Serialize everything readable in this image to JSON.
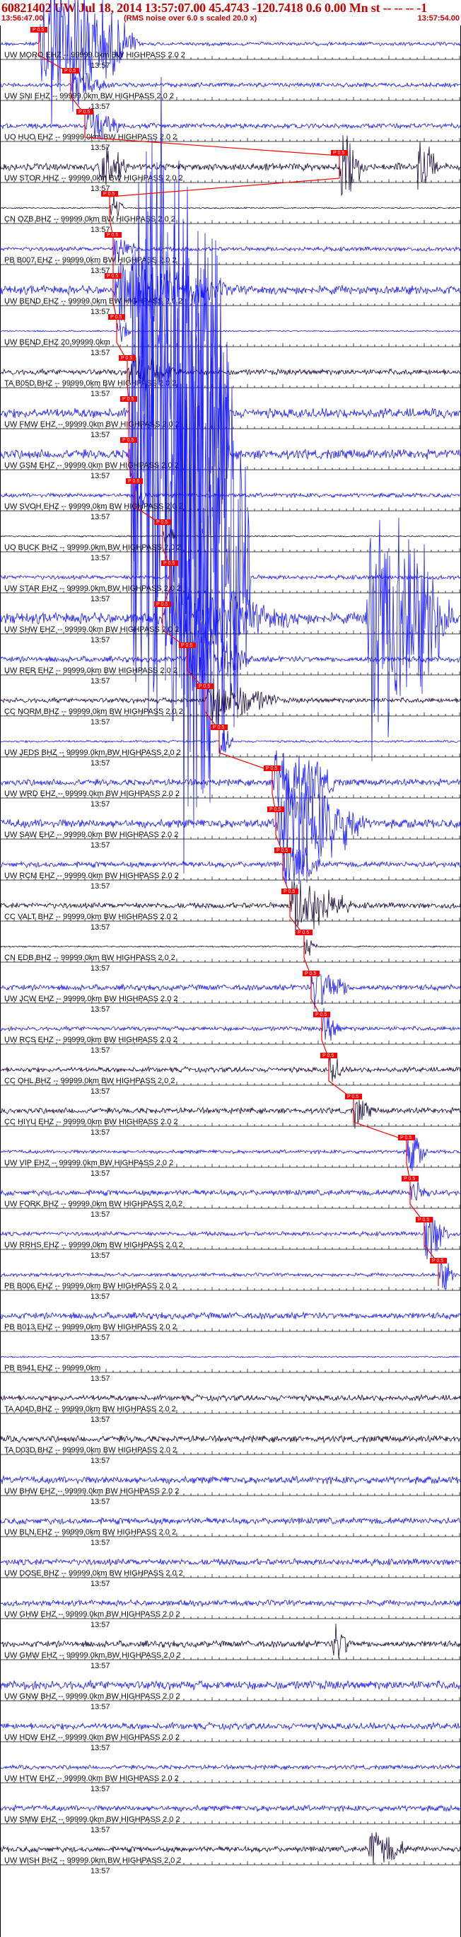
{
  "header": {
    "title": "60821402 UW Jul 18, 2014 13:57:07.00   45.4743 -120.7418  0.6 0.00 Mn st -- -- --  -1",
    "start_time": "13:56:47.00",
    "noise_note": "(RMS noise over 6.0 s scaled 20.0 x)",
    "end_time": "13:57:54.00"
  },
  "colors": {
    "trace_blue": "#1a1aff",
    "trace_dark": "#1a0a3c",
    "pick_red": "#ff0000",
    "text": "#111111",
    "background": "#ffffff"
  },
  "time_tick_label": "13:57",
  "traces": [
    {
      "label": "UW MORO EHZ -- 99999.0km BW  HIGHPASS  2.0  2",
      "color": "blue",
      "amp": 0.5,
      "bursts": [
        [
          55,
          200,
          9,
          0.9
        ]
      ]
    },
    {
      "label": "UW SNI EHZ -- 99999.0km BW  HIGHPASS  2.0  2",
      "color": "blue",
      "amp": 0.6,
      "bursts": [
        [
          100,
          160,
          2,
          1.2
        ]
      ]
    },
    {
      "label": "UO HUO EHZ -- 99999.0km BW  HIGHPASS  2.0  2",
      "color": "blue",
      "amp": 0.7,
      "bursts": [
        [
          120,
          190,
          2,
          1.2
        ]
      ]
    },
    {
      "label": "UW STOR HHZ -- 99999.0km BW  HIGHPASS  2.0  2",
      "color": "dark",
      "amp": 1.0,
      "bursts": [
        [
          480,
          520,
          3,
          0.8
        ],
        [
          590,
          620,
          3,
          0.8
        ],
        [
          140,
          180,
          2,
          0.6
        ]
      ]
    },
    {
      "label": "CN OZB BHZ -- 99999.0km BW  HIGHPASS  2.0  2",
      "color": "dark",
      "amp": 0.2,
      "bursts": [
        [
          155,
          175,
          1.2,
          0.5
        ]
      ]
    },
    {
      "label": "PB B007 EHZ -- 99999.0km BW  HIGHPASS  2.0  2",
      "color": "blue",
      "amp": 0.6,
      "bursts": [
        [
          160,
          200,
          1.6,
          1.0
        ]
      ]
    },
    {
      "label": "UW BEND EHZ -- 99999.0km BW  HIGHPASS  2.0  2",
      "color": "blue",
      "amp": 1.2,
      "bursts": [
        [
          160,
          340,
          3.5,
          1.2
        ]
      ]
    },
    {
      "label": "UW BEND EHZ 20 99999.0km",
      "color": "blue",
      "amp": 0.2,
      "bursts": [
        [
          165,
          185,
          1.2,
          0.5
        ]
      ]
    },
    {
      "label": "TA B05D BHZ -- 99999.0km BW  HIGHPASS  2.0  2",
      "color": "dark",
      "amp": 0.8,
      "bursts": [
        [
          180,
          260,
          2,
          1.0
        ]
      ]
    },
    {
      "label": "UW FMW EHZ -- 99999.0km BW  HIGHPASS  2.0  2",
      "color": "blue",
      "amp": 1.3,
      "bursts": [
        [
          182,
          325,
          30,
          0.3
        ]
      ]
    },
    {
      "label": "UW GSM EHZ -- 99999.0km BW  HIGHPASS  2.0  2",
      "color": "blue",
      "amp": 1.3,
      "bursts": [
        [
          182,
          325,
          30,
          0.3
        ]
      ]
    },
    {
      "label": "UW SVOH EHZ -- 99999.0km BW  HIGHPASS  2.0  2",
      "color": "blue",
      "amp": 0.6,
      "bursts": [
        [
          190,
          210,
          3,
          1.0
        ]
      ]
    },
    {
      "label": "UO BUCK BHZ -- 99999.0km BW  HIGHPASS  2.0  2",
      "color": "dark",
      "amp": 0.2,
      "bursts": [
        [
          230,
          250,
          1.2,
          0.5
        ]
      ]
    },
    {
      "label": "UW STAR EHZ -- 99999.0km BW  HIGHPASS  2.0  2",
      "color": "blue",
      "amp": 0.6,
      "bursts": [
        [
          240,
          355,
          30,
          0.3
        ]
      ]
    },
    {
      "label": "UW SHW EHZ -- 99999.0km BW  HIGHPASS  2.0  2",
      "color": "blue",
      "amp": 1.5,
      "bursts": [
        [
          230,
          450,
          4,
          1.5
        ],
        [
          515,
          645,
          14,
          0.8
        ]
      ]
    },
    {
      "label": "UW RER EHZ -- 99999.0km BW  HIGHPASS  2.0  2",
      "color": "blue",
      "amp": 0.8,
      "bursts": [
        [
          265,
          360,
          4,
          1.0
        ]
      ]
    },
    {
      "label": "CC NORM BHZ -- 99999.0km BW  HIGHPASS  2.0  2",
      "color": "dark",
      "amp": 0.7,
      "bursts": [
        [
          290,
          400,
          2.5,
          1.0
        ]
      ]
    },
    {
      "label": "UW JEDS BHZ -- 99999.0km BW  HIGHPASS  2.0  2",
      "color": "blue",
      "amp": 0.3,
      "bursts": [
        [
          310,
          330,
          1.5,
          0.5
        ]
      ]
    },
    {
      "label": "UW WRD EHZ -- 99999.0km BW  HIGHPASS  2.0  2",
      "color": "blue",
      "amp": 0.9,
      "bursts": [
        [
          385,
          480,
          4,
          0.8
        ]
      ]
    },
    {
      "label": "UW SAW EHZ -- 99999.0km BW  HIGHPASS  2.0  2",
      "color": "blue",
      "amp": 1.2,
      "bursts": [
        [
          390,
          520,
          6,
          0.8
        ]
      ]
    },
    {
      "label": "UW RCM EHZ -- 99999.0km BW  HIGHPASS  2.0  2",
      "color": "blue",
      "amp": 0.8,
      "bursts": [
        [
          400,
          460,
          2.5,
          1.0
        ]
      ]
    },
    {
      "label": "CC VALT BHZ -- 99999.0km BW  HIGHPASS  2.0  2",
      "color": "dark",
      "amp": 0.8,
      "bursts": [
        [
          410,
          500,
          3.5,
          1.0
        ]
      ]
    },
    {
      "label": "CN EDB BHZ -- 99999.0km BW  HIGHPASS  2.0  2",
      "color": "dark",
      "amp": 0.2,
      "bursts": [
        [
          430,
          450,
          1.2,
          0.5
        ]
      ]
    },
    {
      "label": "UW JCW EHZ -- 99999.0km BW  HIGHPASS  2.0  2",
      "color": "blue",
      "amp": 0.8,
      "bursts": [
        [
          440,
          500,
          2.5,
          1.0
        ]
      ]
    },
    {
      "label": "UW RCS EHZ -- 99999.0km BW  HIGHPASS  2.0  2",
      "color": "blue",
      "amp": 0.6,
      "bursts": [
        [
          455,
          485,
          2,
          1.0
        ]
      ]
    },
    {
      "label": "CC OHL BHZ -- 99999.0km BW  HIGHPASS  2.0  2",
      "color": "dark",
      "amp": 0.7,
      "bursts": [
        [
          465,
          490,
          1.5,
          1.0
        ]
      ]
    },
    {
      "label": "CC HIYU EHZ -- 99999.0km BW  HIGHPASS  2.0  2",
      "color": "dark",
      "amp": 0.8,
      "bursts": [
        [
          500,
          530,
          1.5,
          1.0
        ]
      ]
    },
    {
      "label": "UW VIP EHZ -- 99999.0km BW  HIGHPASS  2.0  2",
      "color": "blue",
      "amp": 0.5,
      "bursts": [
        [
          575,
          605,
          2.5,
          1.0
        ]
      ]
    },
    {
      "label": "UW FORK BHZ -- 99999.0km BW  HIGHPASS  2.0  2",
      "color": "blue",
      "amp": 0.8,
      "bursts": [
        [
          580,
          610,
          1.5,
          1.0
        ]
      ]
    },
    {
      "label": "UW RRHS EHZ -- 99999.0km BW  HIGHPASS  2.0  2",
      "color": "blue",
      "amp": 0.6,
      "bursts": [
        [
          600,
          640,
          3,
          1.0
        ]
      ]
    },
    {
      "label": "PB B006 EHZ -- 99999.0km BW  HIGHPASS  2.0  2",
      "color": "blue",
      "amp": 0.5,
      "bursts": [
        [
          620,
          645,
          2,
          1.0
        ]
      ]
    },
    {
      "label": "PB B013 EHZ -- 99999.0km BW  HIGHPASS  2.0  2",
      "color": "blue",
      "amp": 0.9,
      "bursts": []
    },
    {
      "label": "PB B941 EHZ -- 99999.0km",
      "color": "blue",
      "amp": 0.2,
      "bursts": []
    },
    {
      "label": "TA A04D BHZ -- 99999.0km BW  HIGHPASS  2.0  2",
      "color": "dark",
      "amp": 0.8,
      "bursts": []
    },
    {
      "label": "TA D03D BHZ -- 99999.0km BW  HIGHPASS  2.0  2",
      "color": "dark",
      "amp": 0.9,
      "bursts": []
    },
    {
      "label": "UW BHW EHZ -- 99999.0km BW  HIGHPASS  2.0  2",
      "color": "blue",
      "amp": 1.0,
      "bursts": []
    },
    {
      "label": "UW BLN EHZ -- 99999.0km BW  HIGHPASS  2.0  2",
      "color": "blue",
      "amp": 0.9,
      "bursts": []
    },
    {
      "label": "UW DOSE BHZ -- 99999.0km BW  HIGHPASS  2.0  2",
      "color": "blue",
      "amp": 0.9,
      "bursts": []
    },
    {
      "label": "UW GHW EHZ -- 99999.0km BW  HIGHPASS  2.0  2",
      "color": "blue",
      "amp": 0.8,
      "bursts": []
    },
    {
      "label": "UW GMW EHZ -- 99999.0km BW  HIGHPASS  2.0  2",
      "color": "dark",
      "amp": 0.9,
      "bursts": [
        [
          470,
          500,
          2,
          1.0
        ]
      ]
    },
    {
      "label": "UW GNW BHZ -- 99999.0km BW  HIGHPASS  2.0  2",
      "color": "blue",
      "amp": 1.2,
      "bursts": []
    },
    {
      "label": "UW HDW EHZ -- 99999.0km BW  HIGHPASS  2.0  2",
      "color": "blue",
      "amp": 0.9,
      "bursts": []
    },
    {
      "label": "UW HTW EHZ -- 99999.0km BW  HIGHPASS  2.0  2",
      "color": "blue",
      "amp": 0.6,
      "bursts": []
    },
    {
      "label": "UW SMW EHZ -- 99999.0km BW  HIGHPASS  2.0  2",
      "color": "blue",
      "amp": 0.8,
      "bursts": []
    },
    {
      "label": "UW WISH BHZ -- 99999.0km BW  HIGHPASS  2.0  2",
      "color": "dark",
      "amp": 0.8,
      "bursts": [
        [
          520,
          580,
          2,
          0.9
        ]
      ]
    }
  ],
  "picks": [
    {
      "sta": "UW MORO",
      "label": "P 0.5"
    },
    {
      "sta": "UW SNI",
      "label": "P 0.5"
    },
    {
      "sta": "UO HUO",
      "label": "P 0.5"
    },
    {
      "sta": "UW STOR",
      "label": "P 0.5"
    },
    {
      "sta": "CN OZB",
      "label": "P 0.5"
    },
    {
      "sta": "PB B007",
      "label": "P 0.5"
    },
    {
      "sta": "UW BEND",
      "label": "P 0.5"
    },
    {
      "sta": "TA B05D",
      "label": "P 0.5"
    },
    {
      "sta": "UW FMW",
      "label": "P 0.5"
    },
    {
      "sta": "UW GSM",
      "label": "P 0.5"
    },
    {
      "sta": "UW SVOH",
      "label": "P 0.5"
    },
    {
      "sta": "UO BUCK",
      "label": "P 0.5"
    },
    {
      "sta": "UW STAR",
      "label": "P 0.5"
    },
    {
      "sta": "UW SHW",
      "label": "P 0.5"
    },
    {
      "sta": "UW RER",
      "label": "P 0.5"
    },
    {
      "sta": "CC NORM",
      "label": "P 0.5"
    },
    {
      "sta": "UW JEDS",
      "label": "P 0.5"
    },
    {
      "sta": "UW WRD",
      "label": "P 0.5"
    },
    {
      "sta": "UW SAW",
      "label": "P 0.5"
    },
    {
      "sta": "UW RCM",
      "label": "P 0.5"
    },
    {
      "sta": "CC VALT",
      "label": "P 0.5"
    },
    {
      "sta": "CN EDB",
      "label": "P 0.5"
    },
    {
      "sta": "UW JCW",
      "label": "P 0.5"
    },
    {
      "sta": "UW RCS",
      "label": "P 0.5"
    },
    {
      "sta": "CC OHL",
      "label": "P 0.5"
    },
    {
      "sta": "CC HIYU",
      "label": "P 0.5"
    },
    {
      "sta": "UW VIP",
      "label": "P 0.5"
    },
    {
      "sta": "UW FORK",
      "label": "P 0.5"
    },
    {
      "sta": "UW RRHS",
      "label": "P 0.5"
    },
    {
      "sta": "PB B006",
      "label": "P 0.5"
    }
  ]
}
